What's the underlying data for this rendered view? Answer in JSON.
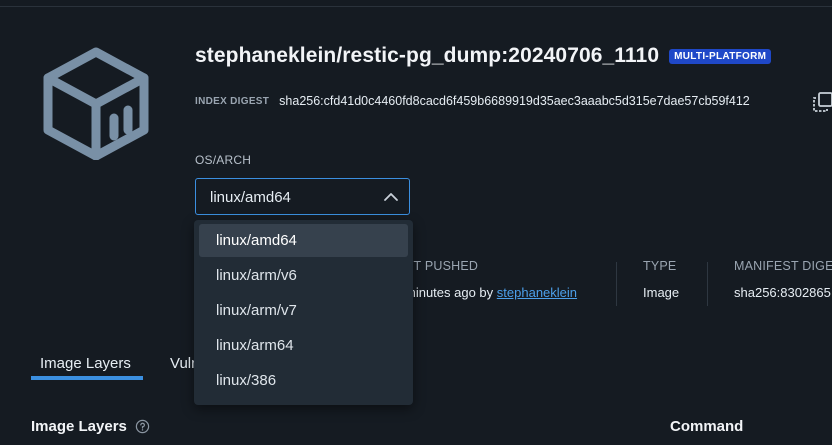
{
  "header": {
    "title": "stephaneklein/restic-pg_dump:20240706_1110",
    "badge": "MULTI-PLATFORM",
    "digest_label": "INDEX DIGEST",
    "digest_value": "sha256:cfd41d0c4460fd8cacd6f459b6689919d35aec3aaabc5d315e7dae57cb59f412"
  },
  "os_arch": {
    "label": "OS/ARCH",
    "selected": "linux/amd64",
    "options": [
      "linux/amd64",
      "linux/arm/v6",
      "linux/arm/v7",
      "linux/arm64",
      "linux/386"
    ]
  },
  "meta": {
    "last_pushed_label": "ST PUSHED",
    "last_pushed_value": "minutes ago by",
    "last_pushed_user": "stephaneklein",
    "type_label": "TYPE",
    "type_value": "Image",
    "manifest_label": "MANIFEST DIGE",
    "manifest_value": "sha256:8302865"
  },
  "tabs": [
    {
      "label": "Image Layers",
      "active": true
    },
    {
      "label": "Vuln",
      "active": false
    }
  ],
  "sections": {
    "layers_title": "Image Layers",
    "command_title": "Command"
  },
  "colors": {
    "background": "#151b22",
    "accent": "#3b8fe0",
    "badge": "#1f48c8",
    "dropdown": "#222c36"
  },
  "icons": {
    "logo": "docker-image-cube-icon",
    "copy": "copy-icon",
    "chevron": "chevron-up-icon",
    "help": "help-circle-icon"
  }
}
